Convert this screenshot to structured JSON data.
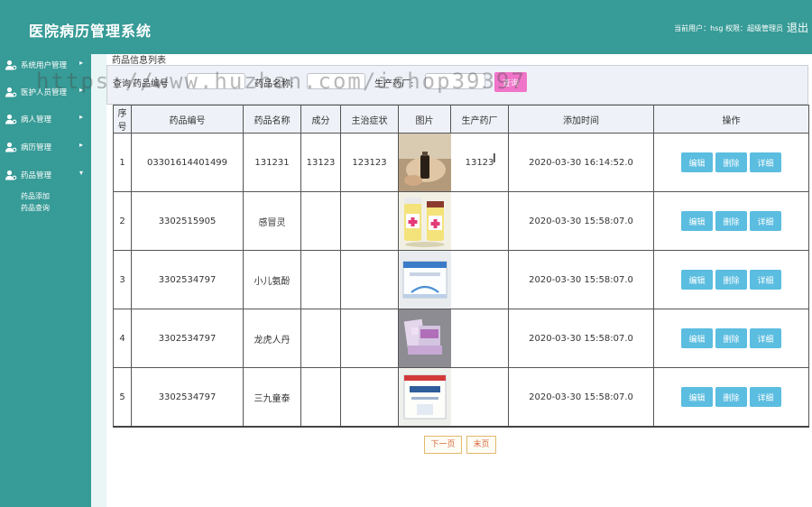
{
  "header": {
    "title": "医院病历管理系统",
    "user_info": "当前用户：hsg  权限：超级管理员",
    "logout_label": "退出"
  },
  "sidebar": {
    "items": [
      {
        "label": "系统用户管理",
        "arrow": "▸"
      },
      {
        "label": "医护人员管理",
        "arrow": "▸"
      },
      {
        "label": "病人管理",
        "arrow": "▸"
      },
      {
        "label": "病历管理",
        "arrow": "▸"
      },
      {
        "label": "药品管理",
        "arrow": "▾"
      }
    ],
    "sub_items": [
      "药品添加",
      "药品查询"
    ]
  },
  "main": {
    "page_title": "药品信息列表",
    "search": {
      "label_prefix": "查询",
      "code_label": "药品编号",
      "name_label": "药品名称:",
      "maker_label": "生产药厂:",
      "code_value": "",
      "name_value": "",
      "maker_value": "",
      "button_label": "查询"
    },
    "table": {
      "headers": [
        "序号",
        "药品编号",
        "药品名称",
        "成分",
        "主治症状",
        "图片",
        "生产药厂",
        "添加时间",
        "操作"
      ],
      "rows": [
        {
          "no": "1",
          "code": "03301614401499",
          "name": "131231",
          "ingredient": "13123",
          "symptom": "123123",
          "image": "bottle-hand-photo",
          "maker": "13123",
          "time": "2020-03-30 16:14:52.0"
        },
        {
          "no": "2",
          "code": "3302515905",
          "name": "感冒灵",
          "ingredient": "",
          "symptom": "",
          "image": "two-pill-bottles-photo",
          "maker": "",
          "time": "2020-03-30 15:58:07.0"
        },
        {
          "no": "3",
          "code": "3302534797",
          "name": "小儿氨酚",
          "ingredient": "",
          "symptom": "",
          "image": "medicine-box-photo",
          "maker": "",
          "time": "2020-03-30 15:58:07.0"
        },
        {
          "no": "4",
          "code": "3302534797",
          "name": "龙虎人丹",
          "ingredient": "",
          "symptom": "",
          "image": "medicine-packs-photo",
          "maker": "",
          "time": "2020-03-30 15:58:07.0"
        },
        {
          "no": "5",
          "code": "3302534797",
          "name": "三九童泰",
          "ingredient": "",
          "symptom": "",
          "image": "medicine-box-blue-photo",
          "maker": "",
          "time": "2020-03-30 15:58:07.0"
        }
      ],
      "actions": {
        "edit": "编辑",
        "delete": "删除",
        "detail": "详细"
      }
    },
    "pager": {
      "next": "下一页",
      "last": "末页"
    }
  },
  "watermark": "https://www.huzhan.com/ishop39397",
  "colors": {
    "primary": "#379b97",
    "query_button": "#f074c9",
    "action_button": "#5bbde0"
  }
}
